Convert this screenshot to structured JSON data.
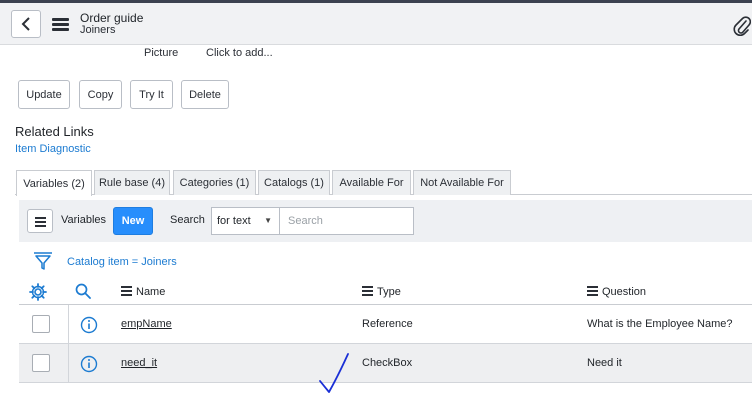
{
  "header": {
    "title": "Order guide",
    "subtitle": "Joiners"
  },
  "form": {
    "picture_label": "Picture",
    "picture_value": "Click to add..."
  },
  "buttons": {
    "update": "Update",
    "copy": "Copy",
    "try_it": "Try It",
    "delete": "Delete"
  },
  "related": {
    "title": "Related Links",
    "item_diagnostic": "Item Diagnostic"
  },
  "tabs": [
    "Variables (2)",
    "Rule base (4)",
    "Categories (1)",
    "Catalogs (1)",
    "Available For",
    "Not Available For"
  ],
  "list": {
    "label": "Variables",
    "new_button": "New",
    "search_label": "Search",
    "search_field": "for text",
    "search_placeholder": "Search",
    "breadcrumb": "Catalog item = Joiners",
    "columns": [
      "Name",
      "Type",
      "Question"
    ],
    "rows": [
      {
        "name": "empName",
        "type": "Reference",
        "question": "What is the Employee Name?"
      },
      {
        "name": "need_it",
        "type": "CheckBox",
        "question": "Need it"
      }
    ]
  },
  "colors": {
    "accent": "#278efc",
    "link": "#1c7bd1",
    "header_bg": "#f1f2f4",
    "annotation_ink": "#1a2fd6"
  }
}
